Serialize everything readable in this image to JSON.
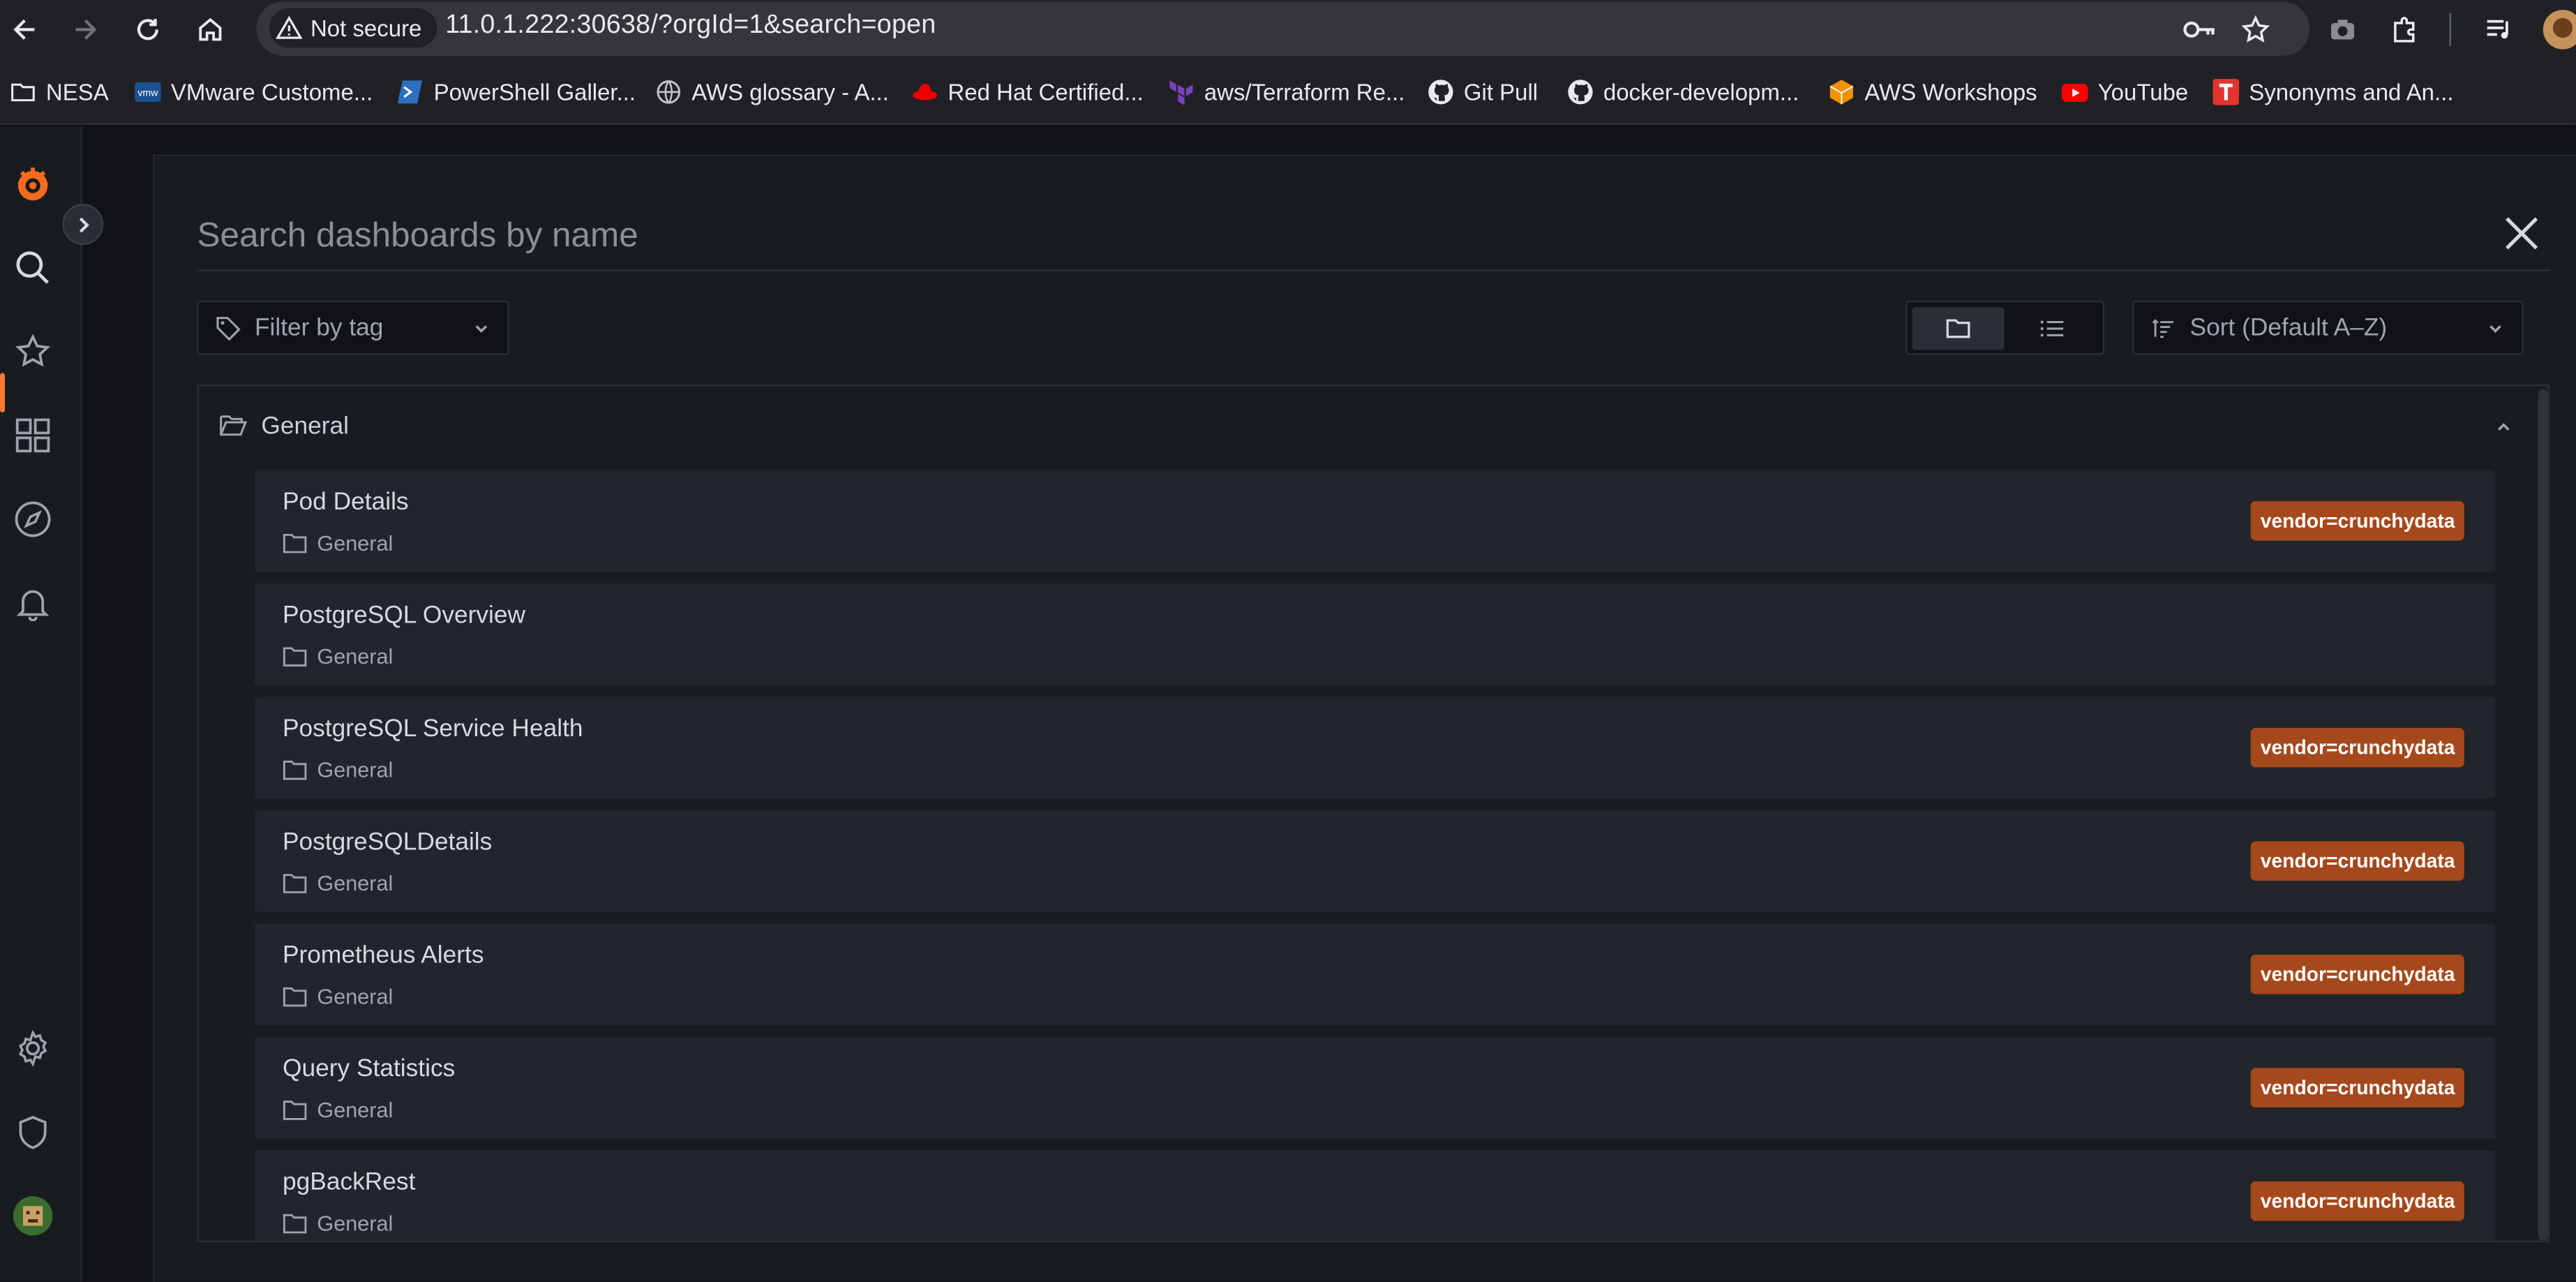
{
  "browser": {
    "security_label": "Not secure",
    "url": "11.0.1.222:30638/?orgId=1&search=open",
    "bookmarks": [
      {
        "label": "NESA",
        "icon": "folder-icon"
      },
      {
        "label": "VMware Custome...",
        "icon": "vmware-icon"
      },
      {
        "label": "PowerShell Galler...",
        "icon": "powershell-icon"
      },
      {
        "label": "AWS glossary - A...",
        "icon": "globe-icon"
      },
      {
        "label": "Red Hat Certified...",
        "icon": "redhat-icon"
      },
      {
        "label": "aws/Terraform Re...",
        "icon": "terraform-icon"
      },
      {
        "label": "Git Pull",
        "icon": "github-icon"
      },
      {
        "label": "docker-developm...",
        "icon": "github-icon"
      },
      {
        "label": "AWS Workshops",
        "icon": "aws-cube-icon"
      },
      {
        "label": "YouTube",
        "icon": "youtube-icon"
      },
      {
        "label": "Synonyms and An...",
        "icon": "thesaurus-icon"
      }
    ]
  },
  "search": {
    "placeholder": "Search dashboards by name",
    "tag_filter_placeholder": "Filter by tag",
    "sort_label": "Sort (Default A–Z)"
  },
  "folder": {
    "name": "General"
  },
  "dashboards": [
    {
      "title": "Pod Details",
      "location": "General",
      "tag": "vendor=crunchydata"
    },
    {
      "title": "PostgreSQL Overview",
      "location": "General",
      "tag": ""
    },
    {
      "title": "PostgreSQL Service Health",
      "location": "General",
      "tag": "vendor=crunchydata"
    },
    {
      "title": "PostgreSQLDetails",
      "location": "General",
      "tag": "vendor=crunchydata"
    },
    {
      "title": "Prometheus Alerts",
      "location": "General",
      "tag": "vendor=crunchydata"
    },
    {
      "title": "Query Statistics",
      "location": "General",
      "tag": "vendor=crunchydata"
    },
    {
      "title": "pgBackRest",
      "location": "General",
      "tag": "vendor=crunchydata"
    }
  ],
  "colors": {
    "accent": "#ff7a32",
    "tag_bg": "#a5481c",
    "panel_bg": "#181b1f",
    "card_bg": "#22252b"
  }
}
